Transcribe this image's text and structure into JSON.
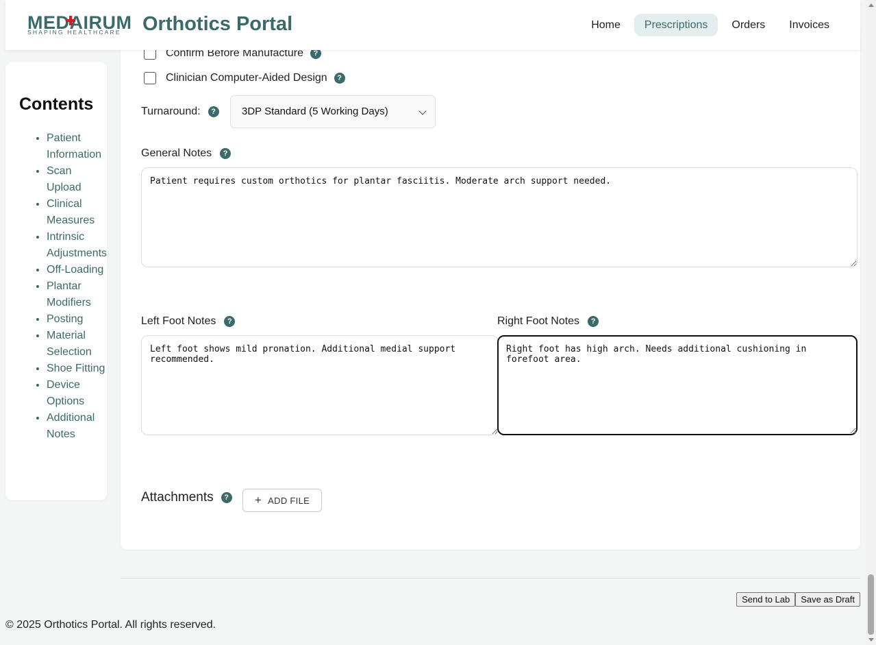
{
  "header": {
    "logo_text": "MEDAIRUM",
    "logo_tagline": "SHAPING HEALTHCARE",
    "app_title": "Orthotics Portal",
    "nav": [
      {
        "label": "Home",
        "active": false
      },
      {
        "label": "Prescriptions",
        "active": true
      },
      {
        "label": "Orders",
        "active": false
      },
      {
        "label": "Invoices",
        "active": false
      }
    ]
  },
  "sidebar": {
    "title": "Contents",
    "items": [
      "Patient Information",
      "Scan Upload",
      "Clinical Measures",
      "Intrinsic Adjustments",
      "Off-Loading",
      "Plantar Modifiers",
      "Posting",
      "Material Selection",
      "Shoe Fitting",
      "Device Options",
      "Additional Notes"
    ]
  },
  "form": {
    "confirm_before_manufacture": {
      "label": "Confirm Before Manufacture",
      "checked": false
    },
    "clinician_cad": {
      "label": "Clinician Computer-Aided Design",
      "checked": false
    },
    "turnaround": {
      "label": "Turnaround:",
      "value": "3DP Standard (5 Working Days)"
    },
    "general_notes": {
      "label": "General Notes",
      "value": "Patient requires custom orthotics for plantar fasciitis. Moderate arch support needed."
    },
    "left_foot_notes": {
      "label": "Left Foot Notes",
      "value": "Left foot shows mild pronation. Additional medial support recommended."
    },
    "right_foot_notes": {
      "label": "Right Foot Notes",
      "value": "Right foot has high arch. Needs additional cushioning in forefoot area."
    },
    "attachments": {
      "label": "Attachments",
      "add_file_label": "ADD FILE"
    },
    "help_glyph": "?"
  },
  "actions": {
    "send_to_lab": "Send to Lab",
    "save_as_draft": "Save as Draft"
  },
  "footer": {
    "copyright": "© 2025 Orthotics Portal. All rights reserved."
  },
  "colors": {
    "brand": "#3a6a6a",
    "logo_cross": "#c8202a",
    "nav_active_bg": "#e4eeee"
  }
}
